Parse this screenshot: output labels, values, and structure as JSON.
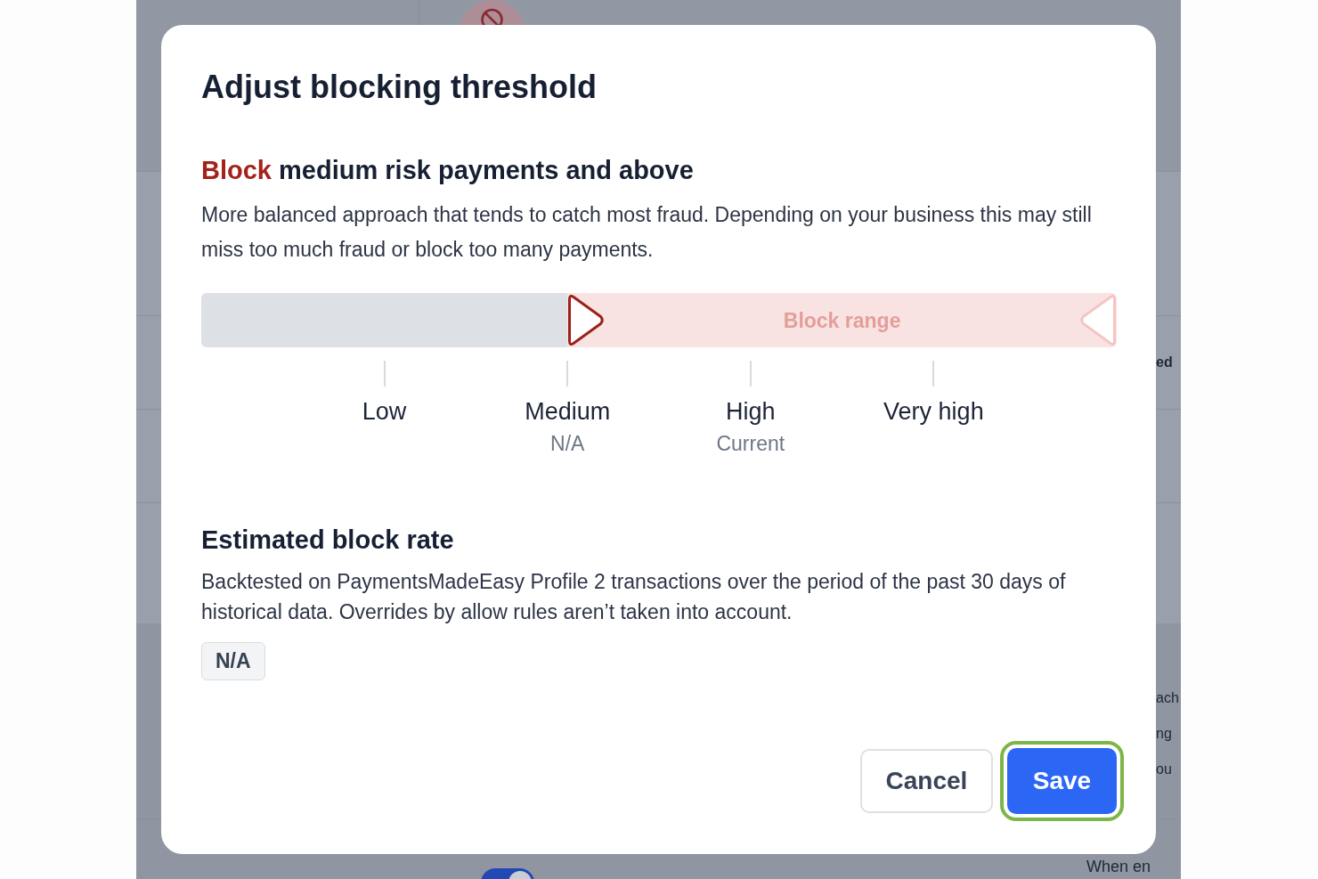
{
  "background": {
    "section_label": "ed",
    "paragraph_lines": [
      "ach",
      "ng",
      "ou"
    ],
    "toggle": {
      "on": true
    },
    "footer_text": "When en"
  },
  "dialog": {
    "title": "Adjust blocking threshold",
    "heading": {
      "action": "Block",
      "text": "medium risk payments and above"
    },
    "description": "More balanced approach that tends to catch most fraud. Depending on your business this may still miss too much fraud or block too many payments.",
    "threshold": {
      "level": 0.4,
      "range_label": "Block range",
      "marks": [
        {
          "label": "Low"
        },
        {
          "label": "Medium",
          "note": "N/A"
        },
        {
          "label": "High",
          "note": "Current"
        },
        {
          "label": "Very high"
        }
      ]
    },
    "estimate": {
      "title": "Estimated block rate",
      "description": "Backtested on PaymentsMadeEasy Profile 2 transactions over the period of the past 30 days of historical data. Overrides by allow rules aren’t taken into account.",
      "value": "N/A"
    },
    "buttons": [
      {
        "label": "Cancel",
        "kind": "secondary",
        "focused": false
      },
      {
        "label": "Save",
        "kind": "primary",
        "focused": true
      }
    ]
  }
}
